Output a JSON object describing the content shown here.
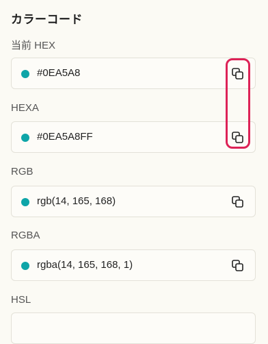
{
  "section_title": "カラーコード",
  "swatch_color": "#0EA5A8",
  "highlight_color": "#dd2257",
  "fields": [
    {
      "label": "当前 HEX",
      "value": "#0EA5A8",
      "icon": "copy-icon"
    },
    {
      "label": "HEXA",
      "value": "#0EA5A8FF",
      "icon": "copy-icon"
    },
    {
      "label": "RGB",
      "value": "rgb(14, 165, 168)",
      "icon": "copy-icon"
    },
    {
      "label": "RGBA",
      "value": "rgba(14, 165, 168, 1)",
      "icon": "copy-icon"
    },
    {
      "label": "HSL",
      "value": "",
      "icon": "copy-icon"
    }
  ]
}
